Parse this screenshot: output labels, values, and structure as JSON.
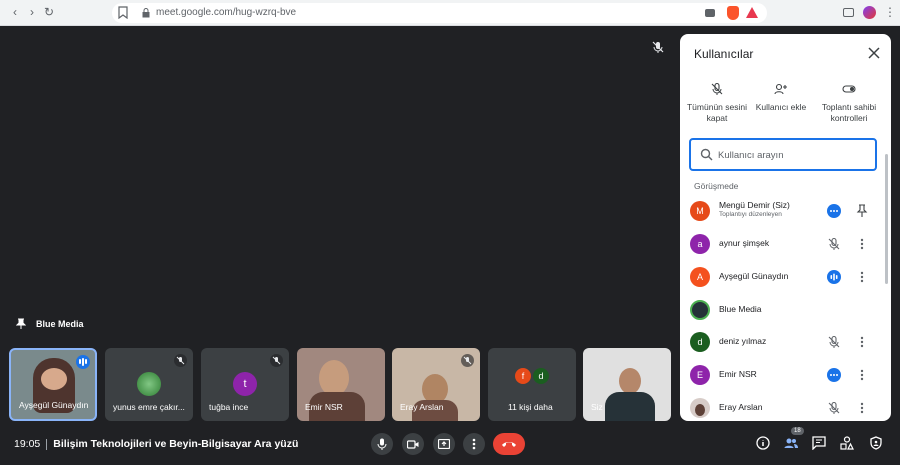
{
  "browser": {
    "url": "meet.google.com/hug-wzrq-bve",
    "nav_back": "‹",
    "nav_forward": "›",
    "nav_reload": "↻",
    "menu": "⋮"
  },
  "stage": {
    "pinned_label": "Blue Media"
  },
  "tiles": [
    {
      "name": "Ayşegül Günaydın",
      "avatar": "",
      "color": "#4e342e"
    },
    {
      "name": "yunus emre çakır...",
      "avatar": "",
      "color": "#4caf50"
    },
    {
      "name": "tuğba ince",
      "avatar": "t",
      "color": "#8e24aa"
    },
    {
      "name": "Emir NSR",
      "avatar": "",
      "color": "#5d4037"
    },
    {
      "name": "Eray Arslan",
      "avatar": "",
      "color": "#6d4c41"
    },
    {
      "name": "11 kişi daha",
      "avatar_a": "f",
      "avatar_b": "d",
      "color_a": "#e64a19",
      "color_b": "#1b5e20"
    },
    {
      "name": "Siz",
      "avatar": "",
      "color": "#d7ccc8"
    }
  ],
  "bottom": {
    "time": "19:05",
    "title": "Bilişim Teknolojileri ve Beyin-Bilgisayar Ara yüzü",
    "people_count": "18"
  },
  "panel": {
    "title": "Kullanıcılar",
    "actions": [
      {
        "label": "Tümünün sesini kapat",
        "icon": "mic-off-icon"
      },
      {
        "label": "Kullanıcı ekle",
        "icon": "add-person-icon"
      },
      {
        "label": "Toplantı sahibi kontrolleri",
        "icon": "toggle-icon"
      }
    ],
    "search_placeholder": "Kullanıcı arayın",
    "section_label": "Görüşmede",
    "participants": [
      {
        "name": "Mengü Demir (Siz)",
        "sub": "Toplantıyı düzenleyen",
        "initial": "M",
        "color": "#e64a19"
      },
      {
        "name": "aynur şimşek",
        "initial": "a",
        "color": "#8e24aa"
      },
      {
        "name": "Ayşegül Günaydın",
        "initial": "A",
        "color": "#f4511e"
      },
      {
        "name": "Blue Media",
        "initial": "",
        "color": "#263238"
      },
      {
        "name": "deniz yılmaz",
        "initial": "d",
        "color": "#1b5e20"
      },
      {
        "name": "Emir NSR",
        "initial": "E",
        "color": "#8e24aa"
      },
      {
        "name": "Eray Arslan",
        "initial": "",
        "color": "#5d4037"
      }
    ]
  }
}
